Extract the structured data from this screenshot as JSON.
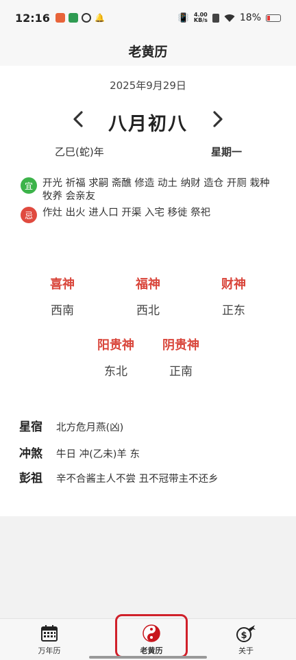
{
  "status_bar": {
    "time": "12:16",
    "net_speed_value": "4.00",
    "net_speed_unit": "KB/s",
    "battery": "18%"
  },
  "header": {
    "title": "老黄历"
  },
  "calendar": {
    "solar_date": "2025年9月29日",
    "prev_arrow": "‹",
    "next_arrow": "›",
    "lunar_date": "八月初八",
    "ganzhi_year": "乙巳(蛇)年",
    "weekday": "星期一"
  },
  "yiji": {
    "yi_badge": "宜",
    "yi_text": "开光 祈福 求嗣 斋醮 修造 动土 纳财 造仓 开厕 栽种 牧养 会亲友",
    "ji_badge": "忌",
    "ji_text": "作灶 出火 进人口 开渠 入宅 移徙 祭祀"
  },
  "gods": [
    {
      "name": "喜神",
      "direction": "西南"
    },
    {
      "name": "福神",
      "direction": "西北"
    },
    {
      "name": "财神",
      "direction": "正东"
    },
    {
      "name": "阳贵神",
      "direction": "东北"
    },
    {
      "name": "阴贵神",
      "direction": "正南"
    }
  ],
  "info": [
    {
      "label": "星宿",
      "value": "北方危月燕(凶)"
    },
    {
      "label": "冲煞",
      "value": "牛日 冲(乙未)羊 东"
    },
    {
      "label": "彭祖",
      "value": "辛不合酱主人不尝 丑不冠带主不还乡"
    }
  ],
  "tabs": [
    {
      "label": "万年历",
      "icon": "calendar-icon"
    },
    {
      "label": "老黄历",
      "icon": "yin-yang-icon"
    },
    {
      "label": "关于",
      "icon": "dollar-plane-icon"
    }
  ],
  "colors": {
    "accent_red": "#d9463b",
    "yi_green": "#3cb34a",
    "ji_red": "#e04a3f",
    "highlight": "#d0202a"
  }
}
